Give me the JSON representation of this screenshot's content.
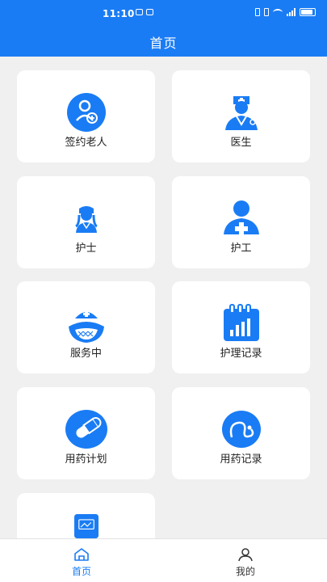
{
  "status_bar": {
    "time": "11:10",
    "battery_level": 0.8
  },
  "header": {
    "title": "首页"
  },
  "grid": {
    "items": [
      {
        "label": "签约老人",
        "icon": "elderly-contract-icon"
      },
      {
        "label": "医生",
        "icon": "doctor-icon"
      },
      {
        "label": "护士",
        "icon": "nurse-icon"
      },
      {
        "label": "护工",
        "icon": "caregiver-icon"
      },
      {
        "label": "服务中",
        "icon": "in-service-icon"
      },
      {
        "label": "护理记录",
        "icon": "care-record-icon"
      },
      {
        "label": "用药计划",
        "icon": "medication-plan-icon"
      },
      {
        "label": "用药记录",
        "icon": "medication-record-icon"
      },
      {
        "label": "",
        "icon": "picture-card-icon"
      }
    ]
  },
  "tabbar": {
    "home_label": "首页",
    "profile_label": "我的",
    "active_tab": "首页"
  },
  "colors": {
    "brand": "#1a7cf4",
    "background": "#f0f0f0",
    "card": "#ffffff"
  }
}
